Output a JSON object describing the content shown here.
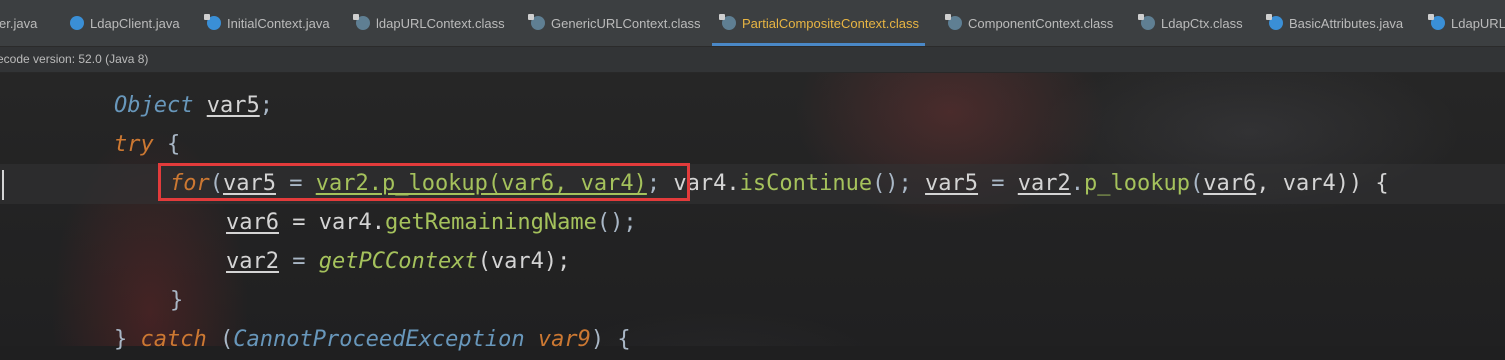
{
  "tabs": [
    {
      "label": "er.java",
      "icon": "none",
      "active": false
    },
    {
      "label": "LdapClient.java",
      "icon": "java-class-icon",
      "active": false
    },
    {
      "label": "InitialContext.java",
      "icon": "java-class-icon",
      "active": false
    },
    {
      "label": "ldapURLContext.class",
      "icon": "compiled-class-icon",
      "active": false
    },
    {
      "label": "GenericURLContext.class",
      "icon": "compiled-class-icon",
      "active": false
    },
    {
      "label": "PartialCompositeContext.class",
      "icon": "compiled-class-icon",
      "active": true
    },
    {
      "label": "ComponentContext.class",
      "icon": "compiled-class-icon",
      "active": false
    },
    {
      "label": "LdapCtx.class",
      "icon": "compiled-class-icon",
      "active": false
    },
    {
      "label": "BasicAttributes.java",
      "icon": "java-class-icon",
      "active": false
    },
    {
      "label": "LdapURL.",
      "icon": "java-class-icon",
      "active": false
    }
  ],
  "infobar": {
    "text": "ecode version: 52.0 (Java 8)"
  },
  "code": {
    "l1": {
      "t1": "Object",
      "t2": " ",
      "t3": "var5",
      "t4": ";"
    },
    "l2": {
      "t1": "try",
      "t2": " {"
    },
    "l3": {
      "a": "for",
      "b": "(",
      "c": "var5",
      "d": " = ",
      "e": "var2.p_lookup(var6, var4)",
      "f": ";",
      "g": " var4.",
      "h": "isContinue",
      "i": "(); ",
      "j": "var5",
      "k": " = ",
      "l": "var2",
      "m": ".",
      "n": "p_lookup",
      "o": "(",
      "p": "var6",
      "q": ", var4)) {"
    },
    "l4": {
      "a": "var6",
      "b": " = var4.",
      "c": "getRemainingName",
      "d": "();"
    },
    "l5": {
      "a": "var2",
      "b": " = ",
      "c": "getPCContext",
      "d": "(var4);"
    },
    "l6": {
      "a": "}"
    },
    "l7": {
      "a": "} ",
      "b": "catch",
      "c": " (",
      "d": "CannotProceedException",
      "e": " ",
      "f": "var9",
      "g": ") {"
    }
  },
  "colors": {
    "keyword": "#cc7832",
    "type": "#6897bb",
    "method": "#a5c25c",
    "active_tab_text": "#e8b543",
    "highlight_box": "#e23b3b"
  }
}
